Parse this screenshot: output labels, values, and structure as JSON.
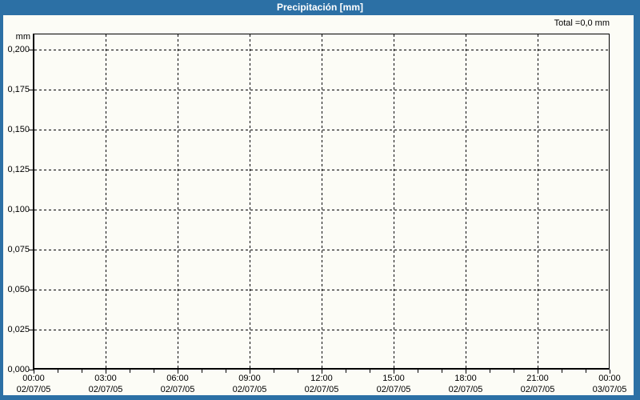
{
  "window": {
    "title": "Precipitación [mm]"
  },
  "colors": {
    "titlebar_bg": "#2C70A5",
    "frame_bg": "#2C70A5",
    "panel_bg": "#FCFCF6",
    "grid": "#000000",
    "title_text": "#FFFFFF",
    "label_text": "#000000"
  },
  "chart_data": {
    "type": "bar",
    "title": "Precipitación [mm]",
    "total": "Total =0,0 mm",
    "y_unit": "mm",
    "ylabel": "mm",
    "xlabel": "",
    "ylim": [
      0,
      0.21
    ],
    "ytick_step": 0.025,
    "grid": "dashed",
    "legend": "none",
    "y_ticks": [
      {
        "value": 0.2,
        "label": "0,200"
      },
      {
        "value": 0.175,
        "label": "0,175"
      },
      {
        "value": 0.15,
        "label": "0,150"
      },
      {
        "value": 0.125,
        "label": "0,125"
      },
      {
        "value": 0.1,
        "label": "0,100"
      },
      {
        "value": 0.075,
        "label": "0,075"
      },
      {
        "value": 0.05,
        "label": "0,050"
      },
      {
        "value": 0.025,
        "label": "0,025"
      },
      {
        "value": 0.0,
        "label": "0,000"
      }
    ],
    "x_ticks": [
      {
        "time": "00:00",
        "date": "02/07/05"
      },
      {
        "time": "03:00",
        "date": "02/07/05"
      },
      {
        "time": "06:00",
        "date": "02/07/05"
      },
      {
        "time": "09:00",
        "date": "02/07/05"
      },
      {
        "time": "12:00",
        "date": "02/07/05"
      },
      {
        "time": "15:00",
        "date": "02/07/05"
      },
      {
        "time": "18:00",
        "date": "02/07/05"
      },
      {
        "time": "21:00",
        "date": "02/07/05"
      },
      {
        "time": "00:00",
        "date": "03/07/05"
      }
    ],
    "x_major_tick_hours": 3,
    "x_minor_tick_hours": 1,
    "series": [
      {
        "name": "Precipitación",
        "values": [],
        "total_mm": 0.0
      }
    ]
  }
}
